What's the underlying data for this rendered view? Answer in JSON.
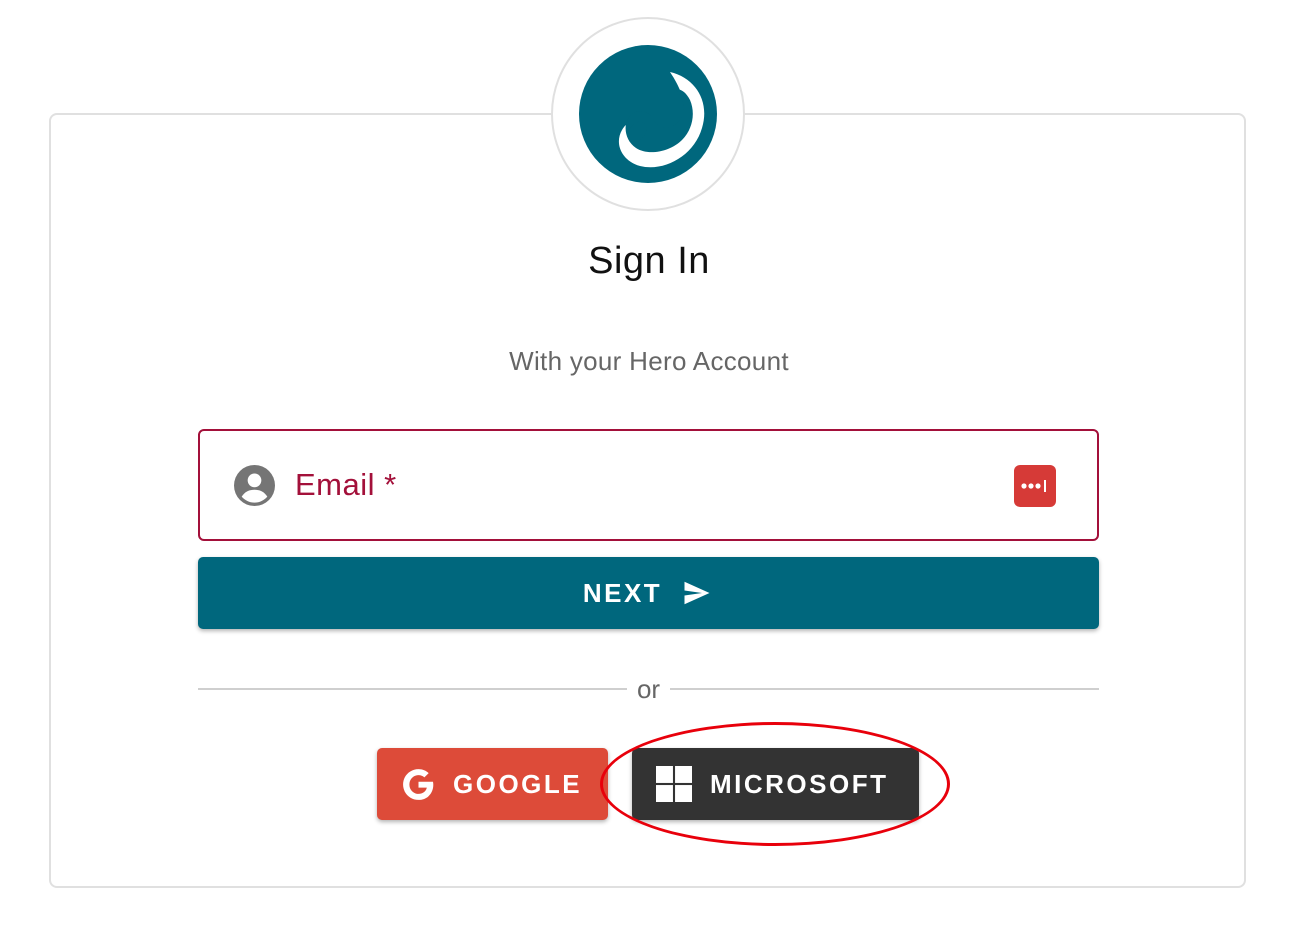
{
  "header": {
    "logo_icon": "hero-logo-icon",
    "title": "Sign In",
    "subtitle": "With your Hero Account"
  },
  "form": {
    "email": {
      "label": "Email *",
      "value": "",
      "leading_icon": "account-circle-icon",
      "trailing_icon": "password-manager-icon"
    },
    "next_button": {
      "label": "NEXT",
      "icon": "send-icon"
    }
  },
  "divider": {
    "text": "or"
  },
  "social": {
    "google": {
      "label": "GOOGLE",
      "icon": "google-icon"
    },
    "microsoft": {
      "label": "MICROSOFT",
      "icon": "windows-icon"
    }
  },
  "colors": {
    "brand": "#00677d",
    "field_error": "#a3103a",
    "google": "#dd4b39",
    "microsoft": "#333333",
    "highlight": "#e8000b"
  }
}
